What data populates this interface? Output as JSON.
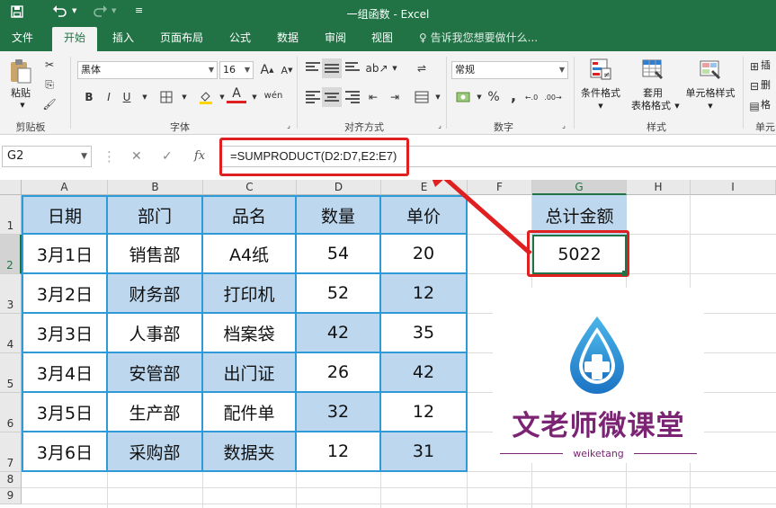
{
  "window": {
    "title": "一组函数 - Excel",
    "accent": "#217346"
  },
  "tabs": [
    {
      "label": "文件",
      "active": false
    },
    {
      "label": "开始",
      "active": true
    },
    {
      "label": "插入",
      "active": false
    },
    {
      "label": "页面布局",
      "active": false
    },
    {
      "label": "公式",
      "active": false
    },
    {
      "label": "数据",
      "active": false
    },
    {
      "label": "审阅",
      "active": false
    },
    {
      "label": "视图",
      "active": false
    }
  ],
  "tell_me": "告诉我您想要做什么...",
  "ribbon": {
    "clipboard": {
      "paste": "粘贴",
      "label": "剪贴板"
    },
    "font": {
      "name": "黑体",
      "size": "16",
      "label": "字体",
      "bold": "B",
      "italic": "I",
      "underline": "U",
      "grow": "A",
      "shrink": "A",
      "color": "A",
      "phonetic": "wén"
    },
    "alignment": {
      "label": "对齐方式"
    },
    "number": {
      "format": "常规",
      "label": "数字",
      "percent": "%",
      "comma": ","
    },
    "styles": {
      "conditional": "条件格式",
      "table_line1": "套用",
      "table_line2": "表格格式",
      "cell_styles": "单元格样式",
      "label": "样式"
    },
    "cells": {
      "insert": "插",
      "delete": "删",
      "format": "格",
      "label": "单元"
    }
  },
  "formula_bar": {
    "name_box": "G2",
    "cancel": "✕",
    "enter": "✓",
    "fx": "fx",
    "formula": "=SUMPRODUCT(D2:D7,E2:E7)"
  },
  "columns": [
    "A",
    "B",
    "C",
    "D",
    "E",
    "F",
    "G",
    "H",
    "I"
  ],
  "rows": [
    "1",
    "2",
    "3",
    "4",
    "5",
    "6",
    "7",
    "8",
    "9"
  ],
  "table": {
    "headers": [
      "日期",
      "部门",
      "品名",
      "数量",
      "单价"
    ],
    "rows": [
      [
        "3月1日",
        "销售部",
        "A4纸",
        "54",
        "20"
      ],
      [
        "3月2日",
        "财务部",
        "打印机",
        "52",
        "12"
      ],
      [
        "3月3日",
        "人事部",
        "档案袋",
        "42",
        "35"
      ],
      [
        "3月4日",
        "安管部",
        "出门证",
        "26",
        "42"
      ],
      [
        "3月5日",
        "生产部",
        "配件单",
        "32",
        "12"
      ],
      [
        "3月6日",
        "采购部",
        "数据夹",
        "12",
        "31"
      ]
    ]
  },
  "total": {
    "header": "总计金额",
    "value": "5022"
  },
  "logo": {
    "name": "文老师微课堂",
    "subtitle": "weiketang",
    "color": "#7b2473"
  }
}
